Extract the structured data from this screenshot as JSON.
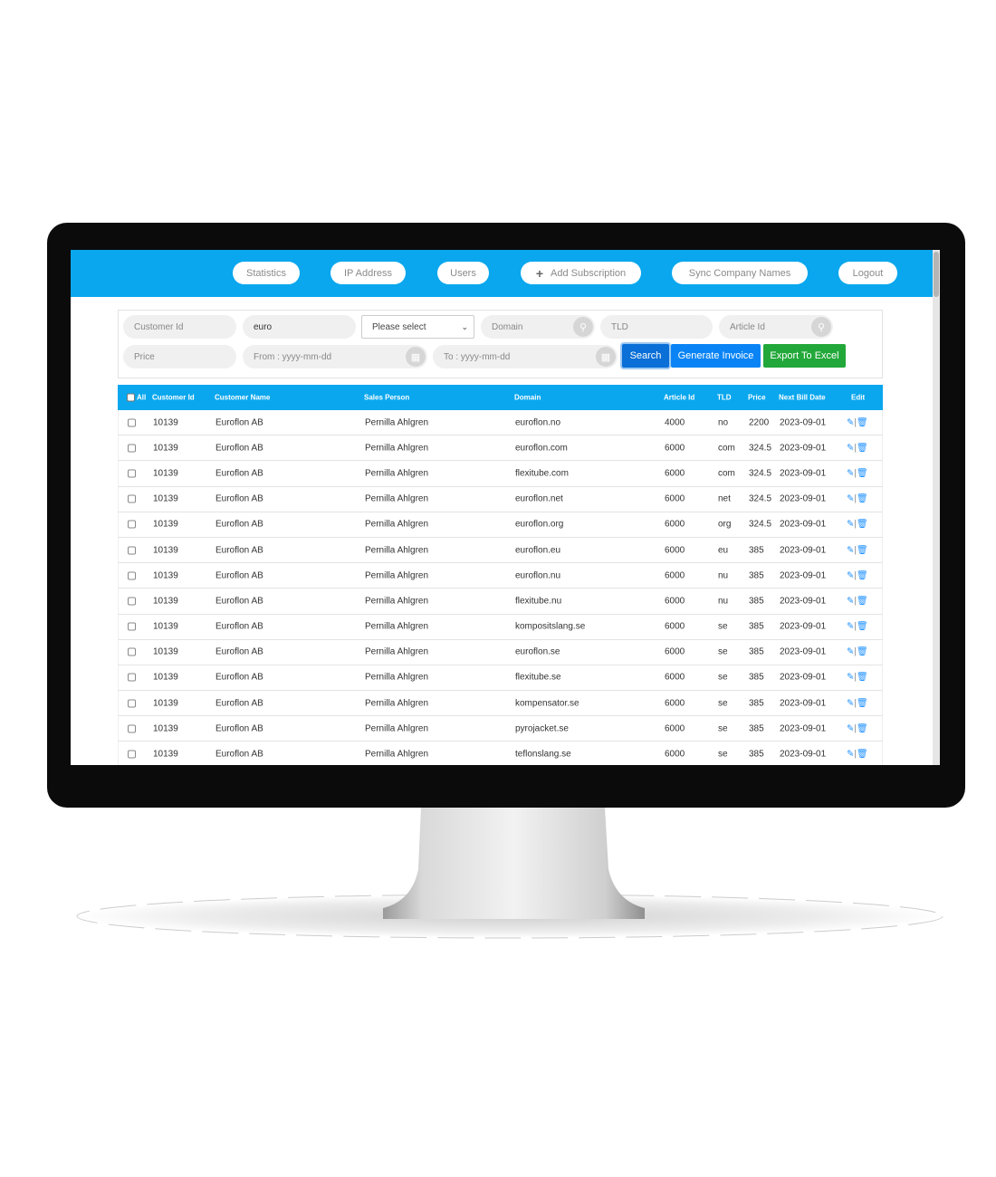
{
  "nav": {
    "statistics": "Statistics",
    "ip_address": "IP Address",
    "users": "Users",
    "add_subscription": "Add Subscription",
    "sync_company_names": "Sync Company Names",
    "logout": "Logout"
  },
  "filters": {
    "customer_id_placeholder": "Customer Id",
    "customer_name_value": "euro",
    "select_value": "Please select",
    "domain_placeholder": "Domain",
    "tld_placeholder": "TLD",
    "article_id_placeholder": "Article Id",
    "price_placeholder": "Price",
    "from_placeholder": "From : yyyy-mm-dd",
    "to_placeholder": "To : yyyy-mm-dd"
  },
  "buttons": {
    "search": "Search",
    "generate_invoice": "Generate Invoice",
    "export_excel": "Export To Excel"
  },
  "colors": {
    "header": "#0aa7ee",
    "search": "#0a6fd6",
    "generate": "#0a84f5",
    "export": "#22a83a"
  },
  "table": {
    "headers": {
      "all": "All",
      "customer_id": "Customer Id",
      "customer_name": "Customer Name",
      "sales_person": "Sales Person",
      "domain": "Domain",
      "article_id": "Article Id",
      "tld": "TLD",
      "price": "Price",
      "next_bill_date": "Next Bill Date",
      "edit": "Edit"
    },
    "rows": [
      [
        "10139",
        "Euroflon AB",
        "Pernilla Ahlgren",
        "euroflon.no",
        "4000",
        "no",
        "2200",
        "2023-09-01"
      ],
      [
        "10139",
        "Euroflon AB",
        "Pernilla Ahlgren",
        "euroflon.com",
        "6000",
        "com",
        "324.5",
        "2023-09-01"
      ],
      [
        "10139",
        "Euroflon AB",
        "Pernilla Ahlgren",
        "flexitube.com",
        "6000",
        "com",
        "324.5",
        "2023-09-01"
      ],
      [
        "10139",
        "Euroflon AB",
        "Pernilla Ahlgren",
        "euroflon.net",
        "6000",
        "net",
        "324.5",
        "2023-09-01"
      ],
      [
        "10139",
        "Euroflon AB",
        "Pernilla Ahlgren",
        "euroflon.org",
        "6000",
        "org",
        "324.5",
        "2023-09-01"
      ],
      [
        "10139",
        "Euroflon AB",
        "Pernilla Ahlgren",
        "euroflon.eu",
        "6000",
        "eu",
        "385",
        "2023-09-01"
      ],
      [
        "10139",
        "Euroflon AB",
        "Pernilla Ahlgren",
        "euroflon.nu",
        "6000",
        "nu",
        "385",
        "2023-09-01"
      ],
      [
        "10139",
        "Euroflon AB",
        "Pernilla Ahlgren",
        "flexitube.nu",
        "6000",
        "nu",
        "385",
        "2023-09-01"
      ],
      [
        "10139",
        "Euroflon AB",
        "Pernilla Ahlgren",
        "kompositslang.se",
        "6000",
        "se",
        "385",
        "2023-09-01"
      ],
      [
        "10139",
        "Euroflon AB",
        "Pernilla Ahlgren",
        "euroflon.se",
        "6000",
        "se",
        "385",
        "2023-09-01"
      ],
      [
        "10139",
        "Euroflon AB",
        "Pernilla Ahlgren",
        "flexitube.se",
        "6000",
        "se",
        "385",
        "2023-09-01"
      ],
      [
        "10139",
        "Euroflon AB",
        "Pernilla Ahlgren",
        "kompensator.se",
        "6000",
        "se",
        "385",
        "2023-09-01"
      ],
      [
        "10139",
        "Euroflon AB",
        "Pernilla Ahlgren",
        "pyrojacket.se",
        "6000",
        "se",
        "385",
        "2023-09-01"
      ],
      [
        "10139",
        "Euroflon AB",
        "Pernilla Ahlgren",
        "teflonslang.se",
        "6000",
        "se",
        "385",
        "2023-09-01"
      ]
    ]
  }
}
